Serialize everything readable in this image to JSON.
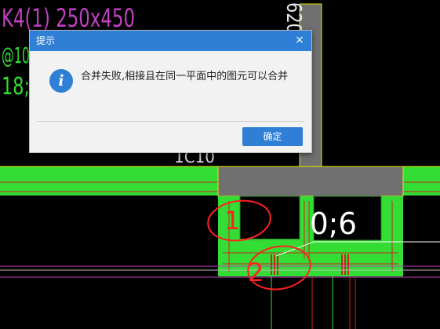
{
  "canvas": {
    "beam_label": "K4(1) 250x450",
    "stirrup_label": "@10",
    "rebar_label": "18;",
    "vertical_label": "620",
    "hidden_label": "1C10",
    "dimension_label": "0;6",
    "annotation_1": "1",
    "annotation_2": "2"
  },
  "dialog": {
    "title": "提示",
    "close_glyph": "×",
    "icon_glyph": "i",
    "message": "合并失败,相接且在同一平面中的图元可以合并",
    "ok_label": "确定"
  },
  "colors": {
    "background": "#000000",
    "green": "#33dd33",
    "gray": "#707070",
    "magenta": "#c040c0",
    "red_annotation": "#ff2020",
    "dialog_blue": "#2f7fd6"
  }
}
